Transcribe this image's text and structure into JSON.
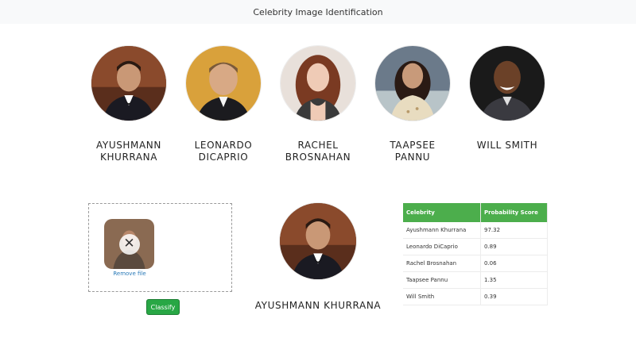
{
  "page": {
    "title": "Celebrity Image Identification"
  },
  "celebrities": [
    {
      "line1": "AYUSHMANN",
      "line2": "KHURRANA",
      "icon": "celebrity-ayushmann-khurrana-photo"
    },
    {
      "line1": "LEONARDO",
      "line2": "DICAPRIO",
      "icon": "celebrity-leonardo-dicaprio-photo"
    },
    {
      "line1": "RACHEL",
      "line2": "BROSNAHAN",
      "icon": "celebrity-rachel-brosnahan-photo"
    },
    {
      "line1": "TAAPSEE",
      "line2": "PANNU",
      "icon": "celebrity-taapsee-pannu-photo"
    },
    {
      "line1": "WILL SMITH",
      "line2": "",
      "icon": "celebrity-will-smith-photo"
    }
  ],
  "upload": {
    "remove_label": "Remove file",
    "remove_icon": "close-icon",
    "classify_label": "Classify"
  },
  "result": {
    "name": "AYUSHMANN KHURRANA"
  },
  "table": {
    "headers": [
      "Celebrity",
      "Probability Score"
    ],
    "rows": [
      [
        "Ayushmann Khurrana",
        "97.32"
      ],
      [
        "Leonardo DiCaprio",
        "0.89"
      ],
      [
        "Rachel Brosnahan",
        "0.06"
      ],
      [
        "Taapsee Pannu",
        "1.35"
      ],
      [
        "Will Smith",
        "0.39"
      ]
    ]
  },
  "colors": {
    "header_green": "#4cae4c",
    "button_green": "#28a745",
    "topbar_bg": "#f8f9fa"
  }
}
